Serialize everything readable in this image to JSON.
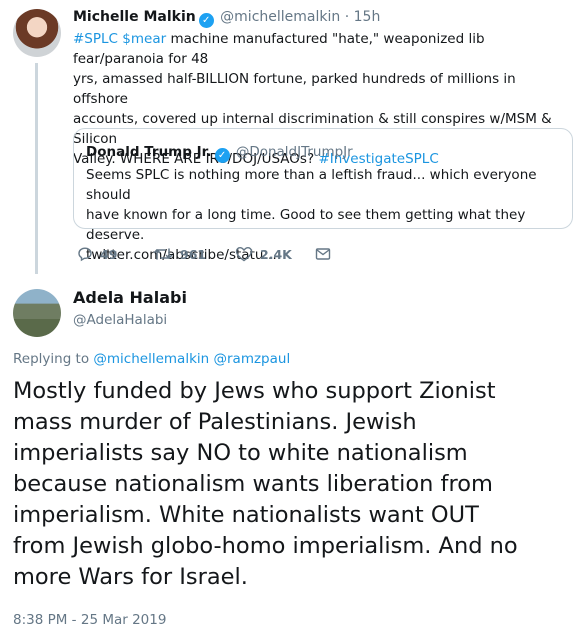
{
  "tweet": {
    "author_name": "Michelle Malkin",
    "author_handle": "@michellemalkin",
    "separator": "·",
    "time": "15h",
    "text_lines": [
      "#SPLC $mear machine manufactured \"hate,\" weaponized lib fear/paranoia for 48",
      "yrs, amassed half-BILLION fortune, parked hundreds of millions in offshore",
      "accounts, covered up internal discrimination & still conspires w/MSM & Silicon",
      "Valley. WHERE ARE IRS/DOJ/USAOs? #InvestigateSPLC"
    ],
    "line1_hashtag": "#SPLC",
    "line1_cashtag": "$mear",
    "line1_rest": " machine manufactured \"hate,\" weaponized lib fear/paranoia for 48",
    "line2": "yrs, amassed half-BILLION fortune, parked hundreds of millions in offshore",
    "line3": "accounts, covered up internal discrimination & still conspires w/MSM & Silicon",
    "line4_text": "Valley. WHERE ARE IRS/DOJ/USAOs? ",
    "line4_hashtag": "#InvestigateSPLC",
    "quote": {
      "author_name": "Donald Trump Jr.",
      "author_handle": "@DonaldJTrumpJr",
      "line1": "Seems SPLC is nothing more than a leftish fraud... which everyone should",
      "line2": "have known for a long time. Good to see them getting what they deserve.",
      "line3": "twitter.com/abscribe/statu…"
    },
    "actions": {
      "replies": "49",
      "retweets": "961",
      "likes": "2.4K"
    }
  },
  "reply": {
    "author_name": "Adela Halabi",
    "author_handle": "@AdelaHalabi",
    "replying_prefix": "Replying to",
    "replying_to_1": "@michellemalkin",
    "replying_to_2": "@ramzpaul",
    "line1": "Mostly funded by Jews who support Zionist",
    "line2": "mass murder of Palestinians. Jewish",
    "line3": "imperialists say NO to white nationalism",
    "line4": "because nationalism wants liberation from",
    "line5": "imperialism. White nationalists want OUT",
    "line6": "from Jewish globo-homo imperialism. And no",
    "line7": "more Wars for Israel.",
    "timestamp": "8:38 PM - 25 Mar 2019"
  },
  "colors": {
    "link": "#1b95e0",
    "muted": "#657786",
    "verified": "#1da1f2",
    "border": "#ccd6dd"
  },
  "icons": [
    "verified-badge-icon",
    "reply-icon",
    "retweet-icon",
    "like-icon",
    "direct-message-icon"
  ]
}
